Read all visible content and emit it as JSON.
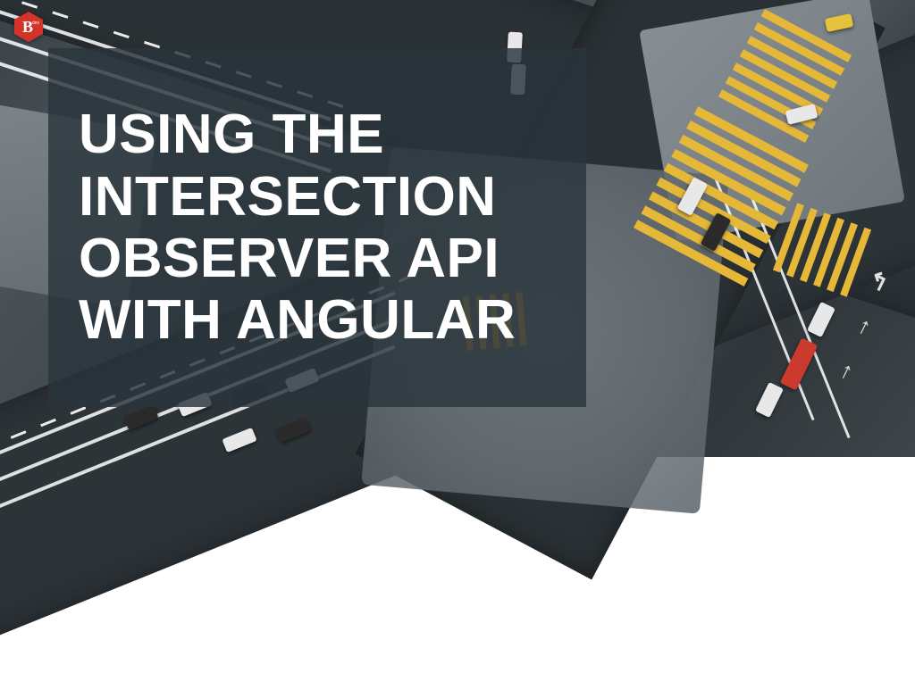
{
  "title_lines": [
    "USING THE",
    "INTERSECTION",
    "OBSERVER API",
    "WITH ANGULAR"
  ],
  "logo": {
    "letter": "B",
    "suffix": "dev"
  }
}
